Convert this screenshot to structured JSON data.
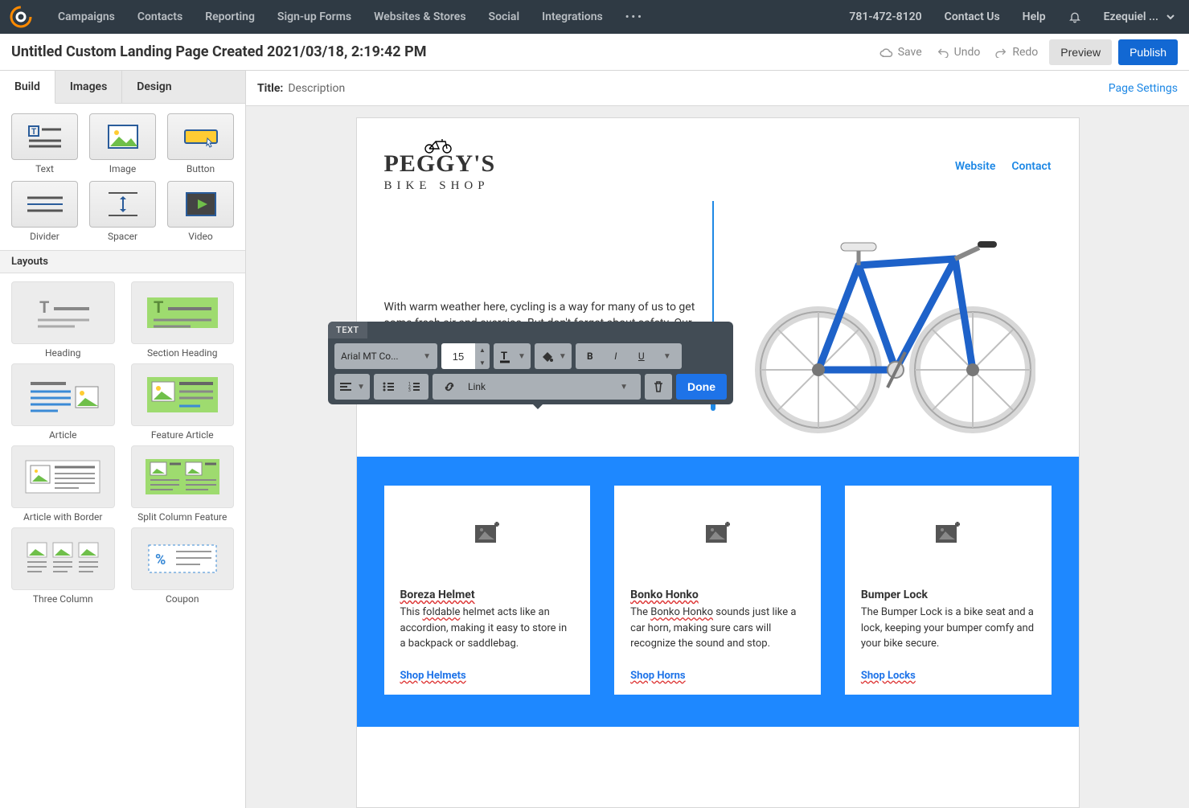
{
  "topnav": {
    "items": [
      "Campaigns",
      "Contacts",
      "Reporting",
      "Sign-up Forms",
      "Websites & Stores",
      "Social",
      "Integrations"
    ],
    "phone": "781-472-8120",
    "contact": "Contact Us",
    "help": "Help",
    "user": "Ezequiel ..."
  },
  "titlebar": {
    "title": "Untitled Custom Landing Page Created 2021/03/18, 2:19:42 PM",
    "save": "Save",
    "undo": "Undo",
    "redo": "Redo",
    "preview": "Preview",
    "publish": "Publish"
  },
  "sidebar": {
    "tabs": [
      "Build",
      "Images",
      "Design"
    ],
    "blocks": [
      "Text",
      "Image",
      "Button",
      "Divider",
      "Spacer",
      "Video"
    ],
    "layouts_label": "Layouts",
    "layouts": [
      "Heading",
      "Section Heading",
      "Article",
      "Feature Article",
      "Article with Border",
      "Split Column Feature",
      "Three Column",
      "Coupon"
    ]
  },
  "canvasbar": {
    "title_label": "Title:",
    "description": "Description",
    "page_settings": "Page Settings"
  },
  "pagecontent": {
    "brand_line1": "PEGGY'S",
    "brand_line2": "BIKE SHOP",
    "nav": {
      "website": "Website",
      "contact": "Contact"
    },
    "hero_para": "With warm weather here, cycling is a way for many of us to get some fresh air and exercise. But don't forget about safety. Our high-quality gear will keep you safe—and looking great!",
    "cards": [
      {
        "title": "Boreza Helmet",
        "desc_pre": "This ",
        "desc_u": "foldable",
        "desc_post": " helmet acts like an accordion, making it easy to store in a backpack or saddlebag.",
        "cta": "Shop Helmets"
      },
      {
        "title": "Bonko Honko",
        "desc_pre": "The ",
        "desc_u": "Bonko Honko",
        "desc_post": " sounds just like a car horn, making sure cars will recognize the sound and stop.",
        "cta": "Shop Horns"
      },
      {
        "title": "Bumper Lock",
        "desc_pre": "",
        "desc_u": "",
        "desc_post": "The Bumper Lock is a bike seat and a lock, keeping your bumper comfy and your bike secure.",
        "cta": "Shop Locks"
      }
    ]
  },
  "toolbar": {
    "label": "TEXT",
    "font": "Arial MT Co...",
    "size": "15",
    "link_label": "Link",
    "done": "Done"
  }
}
